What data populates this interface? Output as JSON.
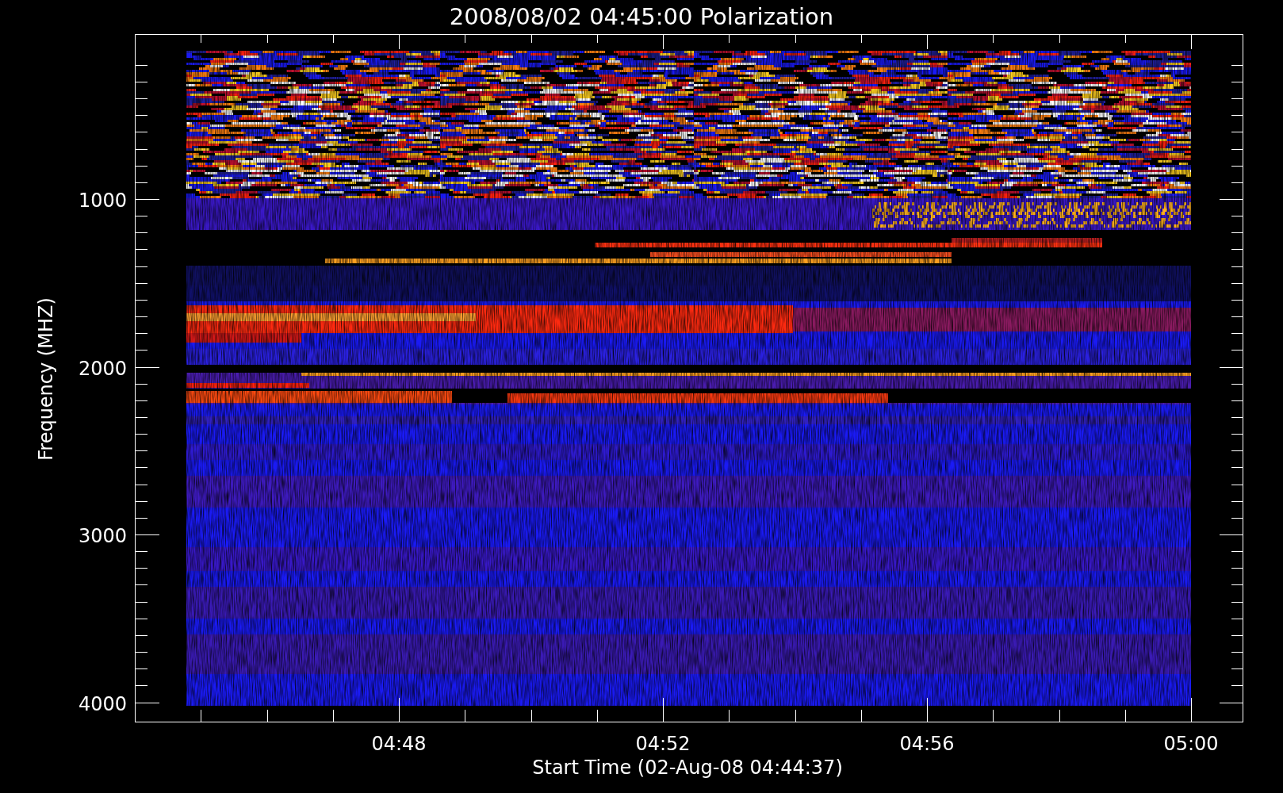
{
  "plot": {
    "title": "2008/08/02 04:45:00 Polarization",
    "ylabel": "Frequency (MHZ)",
    "xlabel": "Start Time (02-Aug-08 04:44:37)",
    "yticks": [
      "1000",
      "2000",
      "3000",
      "4000"
    ],
    "xticks": [
      "04:48",
      "04:52",
      "04:56",
      "05:00"
    ]
  }
}
